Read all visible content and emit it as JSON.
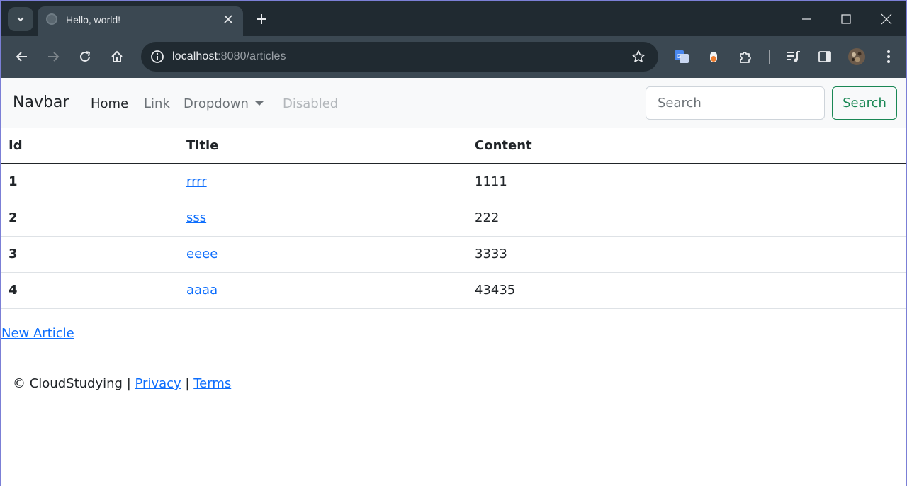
{
  "browser": {
    "tab_title": "Hello, world!",
    "url_host": "localhost",
    "url_rest": ":8080/articles"
  },
  "navbar": {
    "brand": "Navbar",
    "links": [
      "Home",
      "Link",
      "Dropdown",
      "Disabled"
    ],
    "search_placeholder": "Search",
    "search_button": "Search"
  },
  "table": {
    "headers": [
      "Id",
      "Title",
      "Content"
    ],
    "rows": [
      {
        "id": "1",
        "title": "rrrr",
        "content": "1111"
      },
      {
        "id": "2",
        "title": "sss",
        "content": "222"
      },
      {
        "id": "3",
        "title": "eeee",
        "content": "3333"
      },
      {
        "id": "4",
        "title": "aaaa",
        "content": "43435"
      }
    ]
  },
  "new_article": "New Article",
  "footer": {
    "copyright": "© CloudStudying",
    "sep1": "|",
    "privacy": "Privacy",
    "sep2": "|",
    "terms": "Terms"
  },
  "colors": {
    "chrome_dark": "#202a31",
    "chrome_toolbar": "#3b4852",
    "link": "#0d6efd",
    "success": "#198754",
    "navbar_bg": "#f8f9fa"
  }
}
